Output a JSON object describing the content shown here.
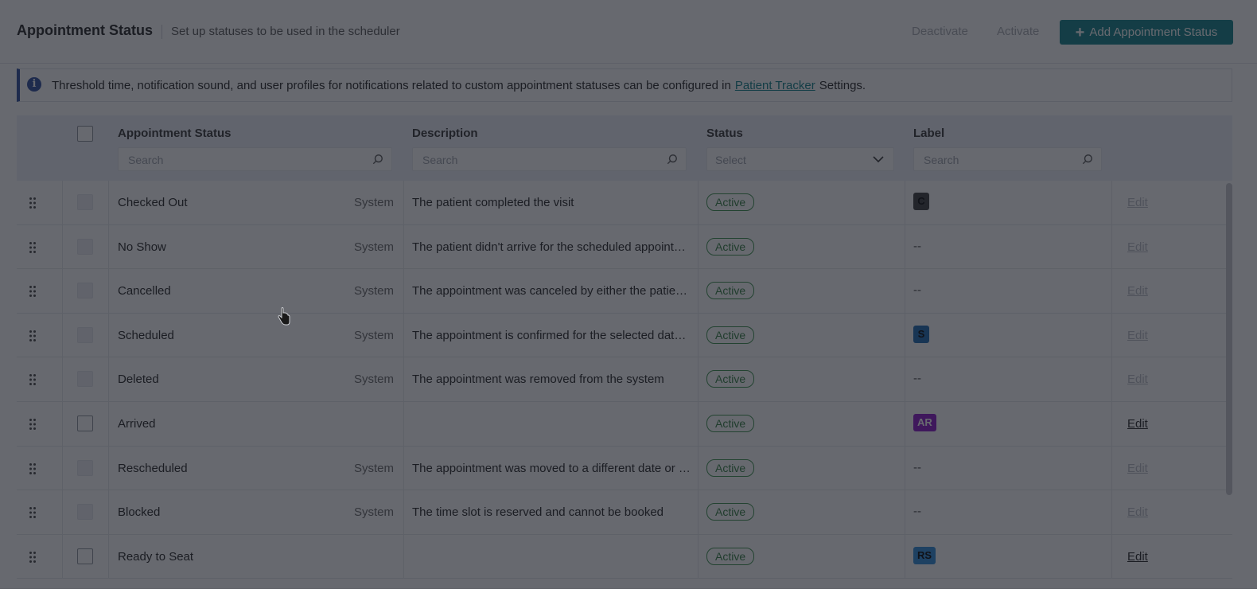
{
  "header": {
    "title": "Appointment Status",
    "subtitle": "Set up statuses to be used in the scheduler",
    "deactivate_label": "Deactivate",
    "activate_label": "Activate",
    "add_label": "Add Appointment Status",
    "add_icon": "plus-icon"
  },
  "banner": {
    "icon": "info-icon",
    "text_before": "Threshold time, notification sound, and user profiles for notifications related to custom appointment statuses can be configured in",
    "link_text": "Patient Tracker",
    "text_after": "Settings."
  },
  "table": {
    "columns": {
      "name": "Appointment Status",
      "description": "Description",
      "status": "Status",
      "label": "Label"
    },
    "filters": {
      "name_placeholder": "Search",
      "description_placeholder": "Search",
      "status_placeholder": "Select",
      "label_placeholder": "Search"
    },
    "rows": [
      {
        "name": "Checked Out",
        "type": "System",
        "description": "The patient completed the visit",
        "status": "Active",
        "label": "C",
        "label_color": "#3a3a3a",
        "label_text_color": "#000000",
        "edit": "Edit",
        "editable": false
      },
      {
        "name": "No Show",
        "type": "System",
        "description": "The patient didn't arrive for the scheduled appointment",
        "status": "Active",
        "label": "--",
        "label_color": "",
        "edit": "Edit",
        "editable": false
      },
      {
        "name": "Cancelled",
        "type": "System",
        "description": "The appointment was canceled by either the patient or the practice",
        "status": "Active",
        "label": "--",
        "label_color": "",
        "edit": "Edit",
        "editable": false
      },
      {
        "name": "Scheduled",
        "type": "System",
        "description": "The appointment is confirmed for the selected date and time",
        "status": "Active",
        "label": "S",
        "label_color": "#1a66b0",
        "label_text_color": "#000000",
        "edit": "Edit",
        "editable": false
      },
      {
        "name": "Deleted",
        "type": "System",
        "description": "The appointment was removed from the system",
        "status": "Active",
        "label": "--",
        "label_color": "",
        "edit": "Edit",
        "editable": false
      },
      {
        "name": "Arrived",
        "type": "",
        "description": "",
        "status": "Active",
        "label": "AR",
        "label_color": "#8a14c8",
        "label_text_color": "#ffffff",
        "edit": "Edit",
        "editable": true
      },
      {
        "name": "Rescheduled",
        "type": "System",
        "description": "The appointment was moved to a different date or time",
        "status": "Active",
        "label": "--",
        "label_color": "",
        "edit": "Edit",
        "editable": false
      },
      {
        "name": "Blocked",
        "type": "System",
        "description": "The time slot is reserved and cannot be booked",
        "status": "Active",
        "label": "--",
        "label_color": "",
        "edit": "Edit",
        "editable": false
      },
      {
        "name": "Ready to Seat",
        "type": "",
        "description": "",
        "status": "Active",
        "label": "RS",
        "label_color": "#2a8ad8",
        "label_text_color": "#000000",
        "edit": "Edit",
        "editable": true
      }
    ]
  },
  "colors": {
    "accent": "#0d7f86",
    "banner_accent": "#2b4a9b",
    "active_badge": "#3a8f4a"
  }
}
